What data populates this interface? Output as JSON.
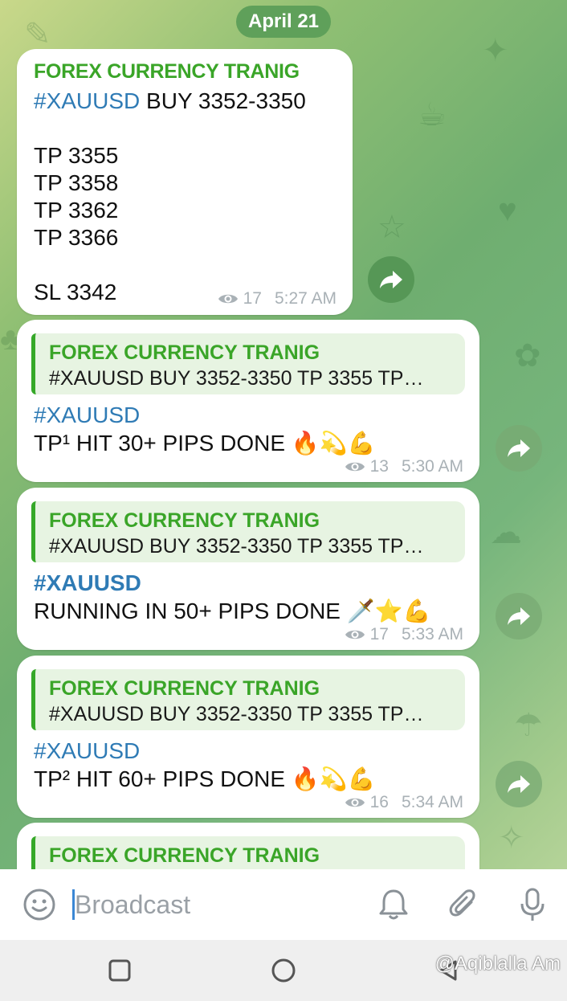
{
  "date_label": "April 21",
  "channel_name": "FOREX CURRENCY TRANIG",
  "reply_preview": "#XAUUSD BUY 3352-3350  TP 3355 TP…",
  "post": {
    "hashtag": "#XAUUSD",
    "title_rest": " BUY 3352-3350",
    "tps": [
      "TP 3355",
      "TP 3358",
      "TP 3362",
      "TP 3366"
    ],
    "sl": "SL 3342",
    "views": "17",
    "time": "5:27 AM"
  },
  "messages": [
    {
      "hashtag": "#XAUUSD",
      "text": "TP¹ HIT 30+ PIPS DONE 🔥💫💪",
      "views": "13",
      "time": "5:30 AM"
    },
    {
      "hashtag": "#XAUUSD",
      "text": "RUNNING IN 50+ PIPS DONE 🗡️⭐💪",
      "views": "17",
      "time": "5:33 AM"
    },
    {
      "hashtag": "#XAUUSD",
      "text": "TP² HIT 60+ PIPS DONE 🔥💫💪",
      "views": "16",
      "time": "5:34 AM"
    }
  ],
  "input": {
    "placeholder": "Broadcast"
  },
  "icons": {
    "emoji": "smile-icon",
    "bell": "bell-icon",
    "attach": "paperclip-icon",
    "mic": "microphone-icon",
    "share": "share-arrow-icon",
    "views": "eye-icon"
  },
  "watermark": "@Aqiblalla Am",
  "colors": {
    "sender": "#3aa528",
    "hashtag": "#2f7bb5",
    "date_pill": "#5fa05a"
  }
}
